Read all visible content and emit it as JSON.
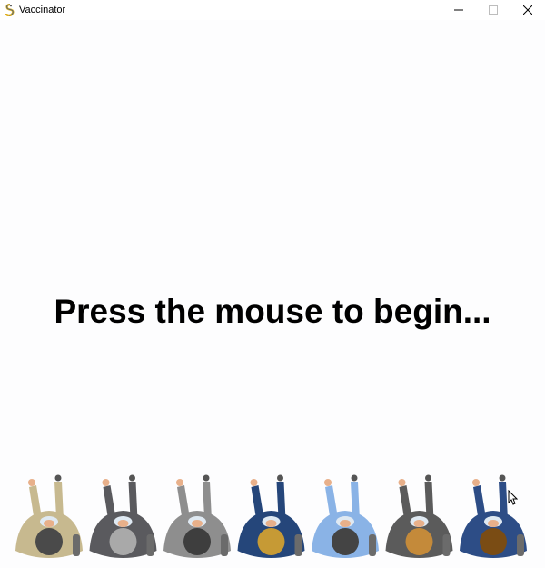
{
  "window": {
    "title": "Vaccinator",
    "icon": "pygame-snake-icon",
    "controls": [
      "minimize-icon",
      "maximize-icon",
      "close-icon"
    ]
  },
  "game": {
    "prompt": "Press the mouse to begin..."
  },
  "crowd": {
    "people": [
      {
        "coat": "#c7b98f",
        "head": "#4a4a4a"
      },
      {
        "coat": "#5a5a5e",
        "head": "#a9a9a9"
      },
      {
        "coat": "#8e8e8e",
        "head": "#3e3e3e"
      },
      {
        "coat": "#25467a",
        "head": "#c69a35"
      },
      {
        "coat": "#8ab3e6",
        "head": "#444444"
      },
      {
        "coat": "#5b5b5b",
        "head": "#c48a3a"
      },
      {
        "coat": "#2d4d86",
        "head": "#7a4c14"
      }
    ]
  }
}
